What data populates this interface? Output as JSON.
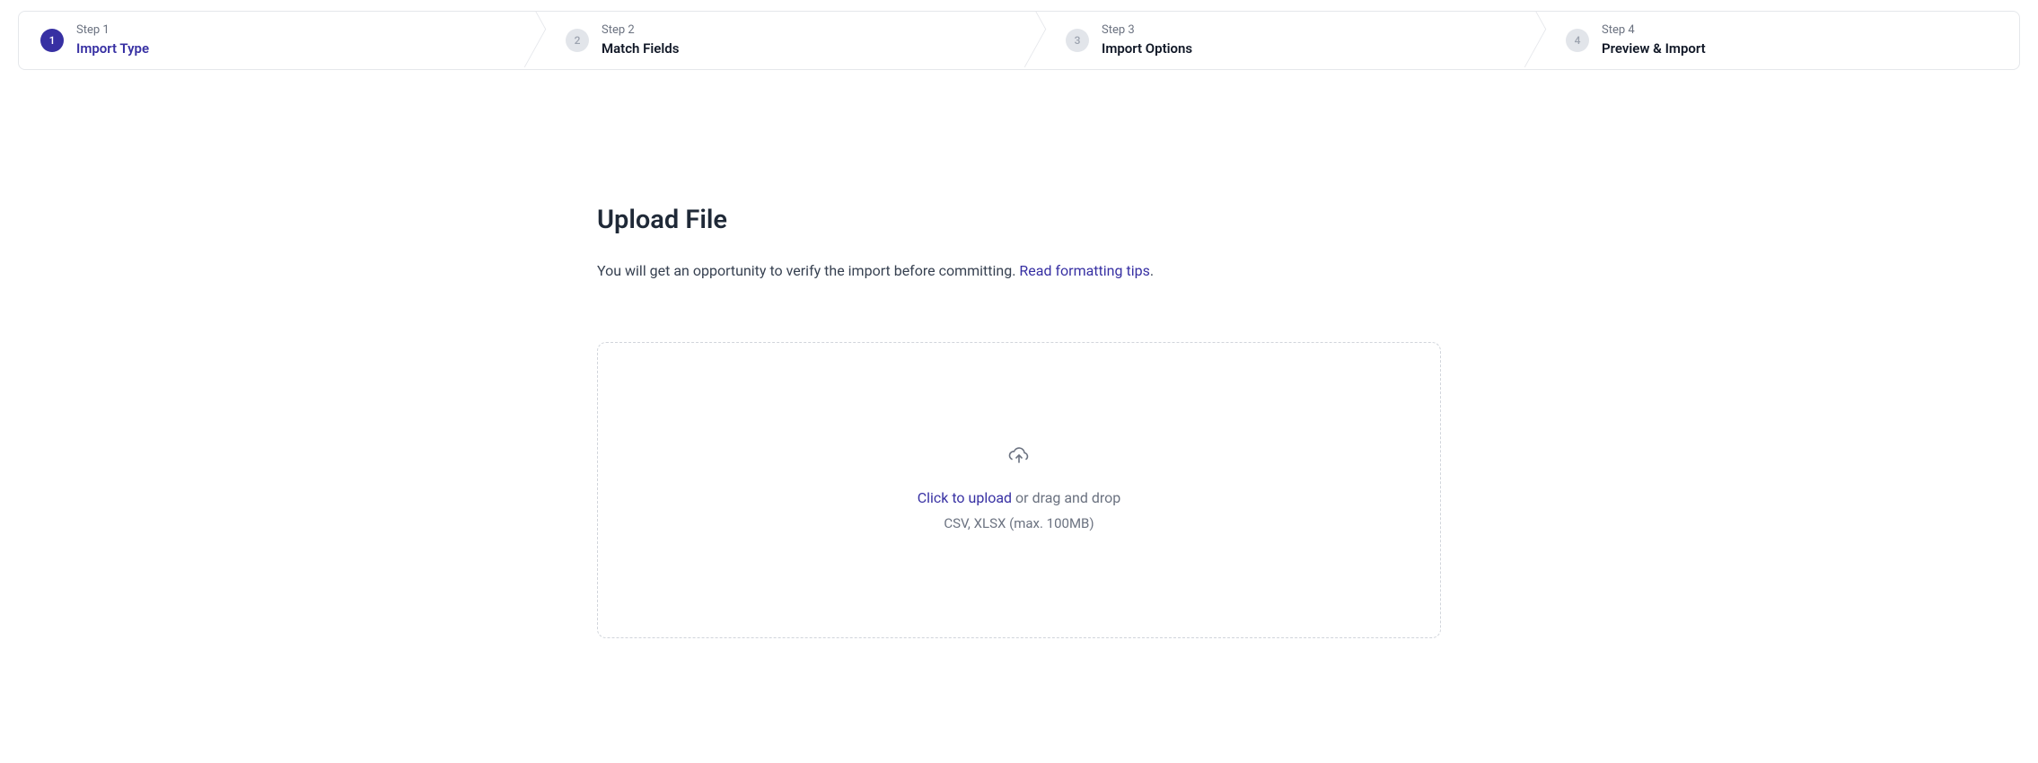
{
  "stepper": {
    "steps": [
      {
        "overline": "Step 1",
        "title": "Import Type",
        "number": "1",
        "active": true
      },
      {
        "overline": "Step 2",
        "title": "Match Fields",
        "number": "2",
        "active": false
      },
      {
        "overline": "Step 3",
        "title": "Import Options",
        "number": "3",
        "active": false
      },
      {
        "overline": "Step 4",
        "title": "Preview & Import",
        "number": "4",
        "active": false
      }
    ]
  },
  "main": {
    "heading": "Upload File",
    "description_prefix": "You will get an opportunity to verify the import before committing. ",
    "description_link": "Read formatting tips",
    "description_suffix": ".",
    "dropzone": {
      "click_label": "Click to upload",
      "drag_label": " or drag and drop",
      "file_hint": "CSV, XLSX (max. 100MB)"
    }
  },
  "colors": {
    "accent": "#3730a3",
    "border": "#e5e7eb",
    "muted": "#6b7280"
  }
}
